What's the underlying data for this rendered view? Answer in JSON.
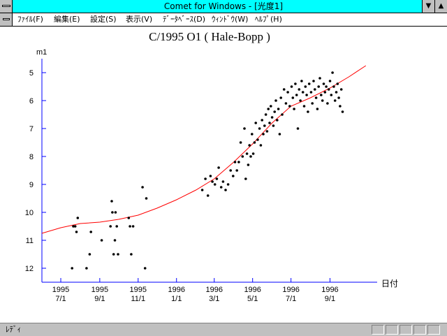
{
  "window": {
    "title": "Comet for Windows - [光度1]",
    "minimize_glyph": "▼",
    "maximize_glyph": "▲"
  },
  "menu": {
    "items": [
      {
        "label": "ﾌｧｲﾙ(F)"
      },
      {
        "label": "編集(E)"
      },
      {
        "label": "設定(S)"
      },
      {
        "label": "表示(V)"
      },
      {
        "label": "ﾃﾞｰﾀﾍﾞｰｽ(D)"
      },
      {
        "label": "ｳｨﾝﾄﾞｳ(W)"
      },
      {
        "label": "ﾍﾙﾌﾟ(H)"
      }
    ]
  },
  "status": {
    "text": "ﾚﾃﾞｨ"
  },
  "colors": {
    "titlebar": "#00ffff",
    "axis": "#0000ff",
    "fit_curve": "#ff0000",
    "points": "#000000"
  },
  "chart_data": {
    "type": "scatter",
    "title": "C/1995 O1 ( Hale-Bopp )",
    "ylabel": "m1",
    "xlabel": "日付",
    "y_inverted": true,
    "ylim": [
      4.5,
      12.5
    ],
    "yticks": [
      5,
      6,
      7,
      8,
      9,
      10,
      11,
      12
    ],
    "xlim": [
      "1995-06-01",
      "1996-11-15"
    ],
    "xticks": [
      {
        "date": "1995-07-01",
        "line1": "1995",
        "line2": "7/1"
      },
      {
        "date": "1995-09-01",
        "line1": "1995",
        "line2": "9/1"
      },
      {
        "date": "1995-11-01",
        "line1": "1995",
        "line2": "11/1"
      },
      {
        "date": "1996-01-01",
        "line1": "1996",
        "line2": "1/1"
      },
      {
        "date": "1996-03-01",
        "line1": "1996",
        "line2": "3/1"
      },
      {
        "date": "1996-05-01",
        "line1": "1996",
        "line2": "5/1"
      },
      {
        "date": "1996-07-01",
        "line1": "1996",
        "line2": "7/1"
      },
      {
        "date": "1996-09-01",
        "line1": "1996",
        "line2": "9/1"
      }
    ],
    "fit_curve": [
      [
        "1995-06-01",
        10.75
      ],
      [
        "1995-07-01",
        10.55
      ],
      [
        "1995-08-01",
        10.4
      ],
      [
        "1995-09-01",
        10.35
      ],
      [
        "1995-10-01",
        10.25
      ],
      [
        "1995-11-01",
        10.1
      ],
      [
        "1995-12-01",
        9.85
      ],
      [
        "1996-01-01",
        9.55
      ],
      [
        "1996-02-01",
        9.2
      ],
      [
        "1996-03-01",
        8.8
      ],
      [
        "1996-04-01",
        8.2
      ],
      [
        "1996-05-01",
        7.55
      ],
      [
        "1996-06-01",
        6.8
      ],
      [
        "1996-07-01",
        6.2
      ],
      [
        "1996-08-01",
        5.9
      ],
      [
        "1996-09-01",
        5.55
      ],
      [
        "1996-10-01",
        5.15
      ],
      [
        "1996-10-28",
        4.75
      ]
    ],
    "series": [
      {
        "points": [
          [
            "1995-07-19",
            12.0
          ],
          [
            "1995-07-21",
            10.5
          ],
          [
            "1995-07-24",
            10.5
          ],
          [
            "1995-07-26",
            10.7
          ],
          [
            "1995-07-28",
            10.2
          ],
          [
            "1995-08-11",
            12.0
          ],
          [
            "1995-08-16",
            11.5
          ],
          [
            "1995-08-18",
            10.7
          ],
          [
            "1995-09-04",
            11.0
          ],
          [
            "1995-09-18",
            10.5
          ],
          [
            "1995-09-20",
            9.6
          ],
          [
            "1995-09-21",
            10.0
          ],
          [
            "1995-09-23",
            11.5
          ],
          [
            "1995-09-26",
            10.0
          ],
          [
            "1995-09-28",
            10.5
          ],
          [
            "1995-09-30",
            11.5
          ],
          [
            "1995-09-25",
            11.0
          ],
          [
            "1995-10-17",
            10.2
          ],
          [
            "1995-10-19",
            10.5
          ],
          [
            "1995-10-21",
            11.5
          ],
          [
            "1995-10-24",
            10.5
          ],
          [
            "1995-11-08",
            9.1
          ],
          [
            "1995-11-12",
            12.0
          ],
          [
            "1995-11-14",
            9.5
          ],
          [
            "1996-02-11",
            9.2
          ],
          [
            "1996-02-16",
            8.8
          ],
          [
            "1996-02-20",
            9.4
          ],
          [
            "1996-02-24",
            8.7
          ],
          [
            "1996-02-27",
            8.9
          ],
          [
            "1996-03-02",
            9.0
          ],
          [
            "1996-03-05",
            8.8
          ],
          [
            "1996-03-08",
            8.4
          ],
          [
            "1996-03-12",
            9.1
          ],
          [
            "1996-03-15",
            8.9
          ],
          [
            "1996-03-19",
            9.2
          ],
          [
            "1996-03-23",
            9.0
          ],
          [
            "1996-03-27",
            8.5
          ],
          [
            "1996-03-31",
            8.7
          ],
          [
            "1996-04-03",
            8.2
          ],
          [
            "1996-04-06",
            8.5
          ],
          [
            "1996-04-09",
            8.2
          ],
          [
            "1996-04-12",
            7.5
          ],
          [
            "1996-04-15",
            8.0
          ],
          [
            "1996-04-18",
            7.0
          ],
          [
            "1996-04-20",
            8.8
          ],
          [
            "1996-04-22",
            7.9
          ],
          [
            "1996-04-24",
            8.3
          ],
          [
            "1996-04-26",
            7.6
          ],
          [
            "1996-04-28",
            8.0
          ],
          [
            "1996-04-30",
            7.2
          ],
          [
            "1996-05-02",
            7.9
          ],
          [
            "1996-05-04",
            7.5
          ],
          [
            "1996-05-06",
            6.8
          ],
          [
            "1996-05-09",
            7.4
          ],
          [
            "1996-05-12",
            7.0
          ],
          [
            "1996-05-14",
            7.6
          ],
          [
            "1996-05-16",
            6.7
          ],
          [
            "1996-05-18",
            7.2
          ],
          [
            "1996-05-20",
            6.9
          ],
          [
            "1996-05-22",
            6.5
          ],
          [
            "1996-05-24",
            7.1
          ],
          [
            "1996-05-26",
            6.3
          ],
          [
            "1996-05-28",
            6.8
          ],
          [
            "1996-05-30",
            6.2
          ],
          [
            "1996-06-01",
            6.6
          ],
          [
            "1996-06-03",
            6.9
          ],
          [
            "1996-06-05",
            6.4
          ],
          [
            "1996-06-07",
            6.0
          ],
          [
            "1996-06-09",
            6.7
          ],
          [
            "1996-06-11",
            6.3
          ],
          [
            "1996-06-13",
            7.2
          ],
          [
            "1996-06-15",
            5.9
          ],
          [
            "1996-06-17",
            6.5
          ],
          [
            "1996-06-20",
            5.6
          ],
          [
            "1996-06-23",
            6.1
          ],
          [
            "1996-06-26",
            5.7
          ],
          [
            "1996-06-29",
            6.2
          ],
          [
            "1996-07-02",
            5.5
          ],
          [
            "1996-07-04",
            5.9
          ],
          [
            "1996-07-06",
            6.3
          ],
          [
            "1996-07-08",
            5.4
          ],
          [
            "1996-07-10",
            5.8
          ],
          [
            "1996-07-12",
            7.0
          ],
          [
            "1996-07-14",
            5.6
          ],
          [
            "1996-07-16",
            6.0
          ],
          [
            "1996-07-18",
            5.3
          ],
          [
            "1996-07-20",
            5.7
          ],
          [
            "1996-07-22",
            6.2
          ],
          [
            "1996-07-24",
            5.5
          ],
          [
            "1996-07-26",
            5.8
          ],
          [
            "1996-07-28",
            6.4
          ],
          [
            "1996-07-30",
            5.4
          ],
          [
            "1996-08-02",
            5.7
          ],
          [
            "1996-08-04",
            6.1
          ],
          [
            "1996-08-06",
            5.3
          ],
          [
            "1996-08-08",
            5.6
          ],
          [
            "1996-08-10",
            5.9
          ],
          [
            "1996-08-12",
            6.3
          ],
          [
            "1996-08-14",
            5.5
          ],
          [
            "1996-08-16",
            5.2
          ],
          [
            "1996-08-18",
            5.8
          ],
          [
            "1996-08-20",
            6.0
          ],
          [
            "1996-08-22",
            5.4
          ],
          [
            "1996-08-24",
            5.7
          ],
          [
            "1996-08-26",
            5.5
          ],
          [
            "1996-08-28",
            6.1
          ],
          [
            "1996-08-30",
            5.6
          ],
          [
            "1996-09-01",
            5.3
          ],
          [
            "1996-09-03",
            5.8
          ],
          [
            "1996-09-05",
            5.0
          ],
          [
            "1996-09-07",
            5.5
          ],
          [
            "1996-09-09",
            6.0
          ],
          [
            "1996-09-11",
            5.7
          ],
          [
            "1996-09-13",
            5.4
          ],
          [
            "1996-09-15",
            5.9
          ],
          [
            "1996-09-17",
            6.2
          ],
          [
            "1996-09-19",
            5.6
          ],
          [
            "1996-09-21",
            6.4
          ]
        ]
      }
    ]
  }
}
